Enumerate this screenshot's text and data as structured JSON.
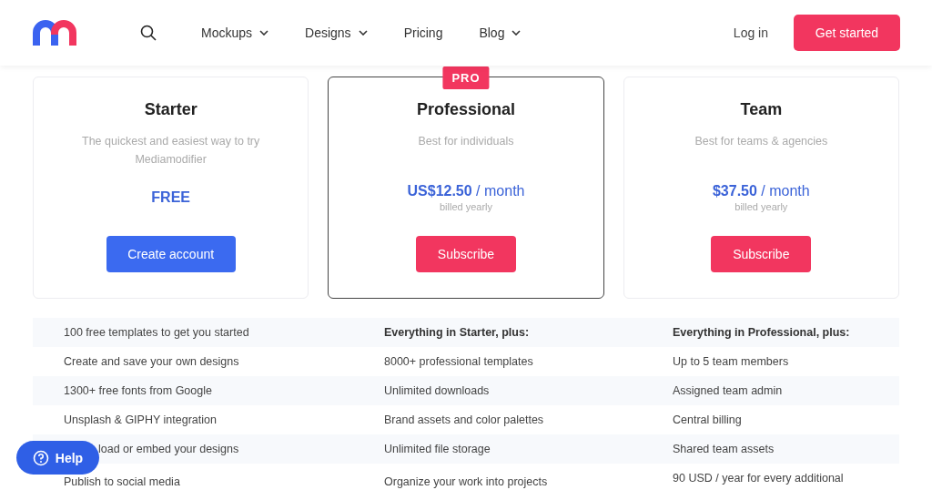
{
  "nav": {
    "items": [
      {
        "label": "Mockups",
        "has_menu": true
      },
      {
        "label": "Designs",
        "has_menu": true
      },
      {
        "label": "Pricing",
        "has_menu": false
      },
      {
        "label": "Blog",
        "has_menu": true
      }
    ],
    "login": "Log in",
    "cta": "Get started"
  },
  "plans": [
    {
      "name": "Starter",
      "description": "The quickest and easiest way to try Mediamodifier",
      "price": "FREE",
      "button": {
        "label": "Create account",
        "kind": "primary"
      },
      "featured": false
    },
    {
      "name": "Professional",
      "badge": "PRO",
      "description": "Best for individuals",
      "price": "**US$12.50** / month",
      "billing": "billed yearly",
      "button": {
        "label": "Subscribe",
        "kind": "accent"
      },
      "featured": true
    },
    {
      "name": "Team",
      "description": "Best for teams & agencies",
      "price": "**$37.50** / month",
      "billing": "billed yearly",
      "button": {
        "label": "Subscribe",
        "kind": "accent"
      },
      "featured": false
    }
  ],
  "features": [
    {
      "cells": [
        {
          "text": "100 free templates to get you started",
          "bold": false
        },
        {
          "text": "Everything in Starter, plus:",
          "bold": true
        },
        {
          "text": "Everything in Professional, plus:",
          "bold": true
        }
      ]
    },
    {
      "cells": [
        {
          "text": "Create and save your own designs",
          "bold": false
        },
        {
          "text": "8000+ professional templates",
          "bold": false
        },
        {
          "text": "Up to 5 team members",
          "bold": false
        }
      ]
    },
    {
      "cells": [
        {
          "text": "1300+ free fonts from Google",
          "bold": false
        },
        {
          "text": "Unlimited downloads",
          "bold": false
        },
        {
          "text": "Assigned team admin",
          "bold": false
        }
      ]
    },
    {
      "cells": [
        {
          "text": "Unsplash & GIPHY integration",
          "bold": false
        },
        {
          "text": "Brand assets and color palettes",
          "bold": false
        },
        {
          "text": "Central billing",
          "bold": false
        }
      ]
    },
    {
      "cells": [
        {
          "text": "load or embed your designs",
          "bold": false
        },
        {
          "text": "Unlimited file storage",
          "bold": false
        },
        {
          "text": "Shared team assets",
          "bold": false
        }
      ]
    },
    {
      "cells": [
        {
          "text": "Publish to social media",
          "bold": false
        },
        {
          "text": "Organize your work into projects",
          "bold": false
        },
        {
          "text": "90 USD / year for every additional",
          "bold": false
        }
      ]
    }
  ],
  "help": "Help"
}
